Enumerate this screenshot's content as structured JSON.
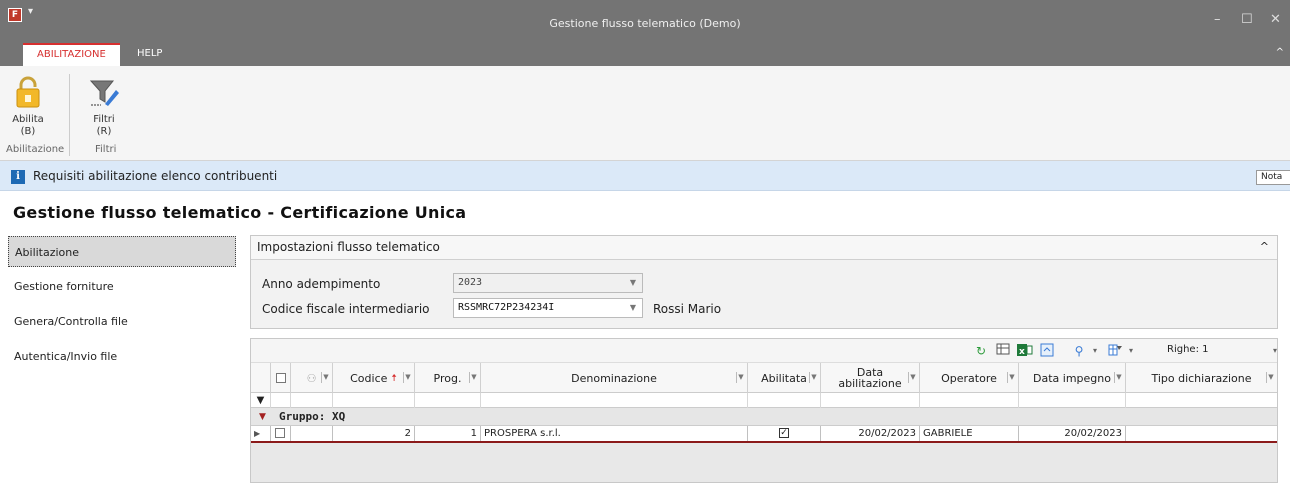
{
  "window": {
    "app_icon": "F",
    "title": "Gestione flusso telematico  (Demo)",
    "controls": {
      "minimize": "–",
      "maximize": "☐",
      "close": "✕"
    }
  },
  "ribbon": {
    "tabs": [
      {
        "label": "ABILITAZIONE",
        "active": true
      },
      {
        "label": "HELP",
        "active": false
      }
    ],
    "collapse_glyph": "^",
    "buttons": [
      {
        "icon": "padlock-icon",
        "label": "Abilita",
        "shortcut": "(B)"
      },
      {
        "icon": "filter-edit-icon",
        "label": "Filtri",
        "shortcut": "(R)"
      }
    ],
    "groups": [
      "Abilitazione",
      "Filtri"
    ]
  },
  "infobar": {
    "icon": "info-icon",
    "text": "Requisiti abilitazione elenco contribuenti",
    "nota_label": "Nota"
  },
  "page_title": "Gestione flusso telematico - Certificazione Unica",
  "nav": {
    "items": [
      {
        "label": "Abilitazione",
        "selected": true
      },
      {
        "label": "Gestione forniture",
        "selected": false
      },
      {
        "label": "Genera/Controlla file",
        "selected": false
      },
      {
        "label": "Autentica/Invio file",
        "selected": false
      }
    ]
  },
  "settings": {
    "title": "Impostazioni flusso telematico",
    "anno_label": "Anno adempimento",
    "anno_value": "2023",
    "cf_label": "Codice fiscale intermediario",
    "cf_value": "RSSMRC72P234234I",
    "cf_name": "Rossi Mario"
  },
  "grid": {
    "toolbar": {
      "icons": [
        "refresh-icon",
        "export-icon",
        "excel-icon",
        "layout-icon",
        "search-icon",
        "column-chooser-icon"
      ],
      "righe_label": "Righe: 1"
    },
    "columns": {
      "codice": "Codice",
      "prog": "Prog.",
      "denominazione": "Denominazione",
      "abilitata": "Abilitata",
      "data_abilitazione": "Data abilitazione",
      "operatore": "Operatore",
      "data_impegno": "Data impegno",
      "tipo_dichiarazione": "Tipo dichiarazione"
    },
    "group_label": "Gruppo: XQ",
    "rows": [
      {
        "codice": "2",
        "prog": "1",
        "denominazione": "PROSPERA s.r.l.",
        "abilitata": true,
        "data_abilitazione": "20/02/2023",
        "operatore": "GABRIELE",
        "data_impegno": "20/02/2023",
        "tipo_dichiarazione": ""
      }
    ]
  },
  "colors": {
    "titlebar": "#747474",
    "accent_red": "#d62f2f",
    "info_bg": "#dbe9f8",
    "info_icon": "#1e6ab4"
  }
}
